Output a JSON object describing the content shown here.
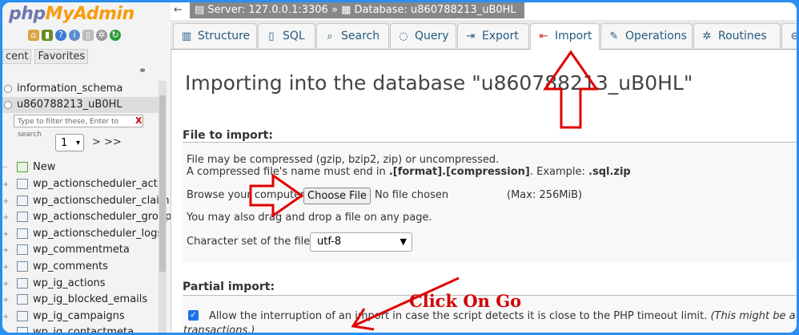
{
  "sidebar": {
    "logo_part1": "php",
    "logo_part2": "MyAdmin",
    "tab_recent": "cent",
    "tab_favorites": "Favorites",
    "databases": [
      {
        "label": "information_schema"
      },
      {
        "label": "u860788213_uB0HL"
      }
    ],
    "filter_placeholder": "Type to filter these, Enter to search",
    "filter_clear": "X",
    "page_select": "1",
    "page_nav": "> >>",
    "new_label": "New",
    "tables": [
      {
        "label": "wp_actionscheduler_actio"
      },
      {
        "label": "wp_actionscheduler_claim"
      },
      {
        "label": "wp_actionscheduler_group"
      },
      {
        "label": "wp_actionscheduler_logs"
      },
      {
        "label": "wp_commentmeta"
      },
      {
        "label": "wp_comments"
      },
      {
        "label": "wp_ig_actions"
      },
      {
        "label": "wp_ig_blocked_emails"
      },
      {
        "label": "wp_ig_campaigns"
      },
      {
        "label": "wp_ig_contactmeta"
      }
    ]
  },
  "breadcrumb": {
    "back": "←",
    "server": "Server: 127.0.0.1:3306",
    "separator": "»",
    "database": "Database: u860788213_uB0HL"
  },
  "tabs": [
    {
      "label": "Structure",
      "icon": "structure-icon"
    },
    {
      "label": "SQL",
      "icon": "sql-icon"
    },
    {
      "label": "Search",
      "icon": "search-icon"
    },
    {
      "label": "Query",
      "icon": "query-icon"
    },
    {
      "label": "Export",
      "icon": "export-icon"
    },
    {
      "label": "Import",
      "icon": "import-icon"
    },
    {
      "label": "Operations",
      "icon": "operations-icon"
    },
    {
      "label": "Routines",
      "icon": "routines-icon"
    }
  ],
  "main": {
    "title": "Importing into the database \"u860788213_uB0HL\"",
    "file_section_title": "File to import:",
    "compress_line1": "File may be compressed (gzip, bzip2, zip) or uncompressed.",
    "compress_line2_a": "A compressed file's name must end in ",
    "compress_line2_b": ".[format].[compression]",
    "compress_line2_c": ". Example: ",
    "compress_line2_d": ".sql.zip",
    "browse_label": "Browse your computer:",
    "choose_file": "Choose File",
    "no_file": "No file chosen",
    "max_size": "(Max: 256MiB)",
    "drag_drop": "You may also drag and drop a file on any page.",
    "charset_label": "Character set of the file:",
    "charset_value": "utf-8",
    "partial_section_title": "Partial import:",
    "allow_interrupt_a": "Allow the interruption of an import in case the script detects it is close to the PHP timeout limit. ",
    "allow_interrupt_b": "(This might be a good way to im",
    "allow_interrupt_c": "transactions.)"
  },
  "annotation": {
    "text": "Click On Go",
    "color": "#d40000"
  },
  "colors": {
    "frame_border": "#2b8ff0",
    "tab_text": "#235a81",
    "logo_php": "#6c78af",
    "logo_myadmin": "#f89c0e"
  }
}
